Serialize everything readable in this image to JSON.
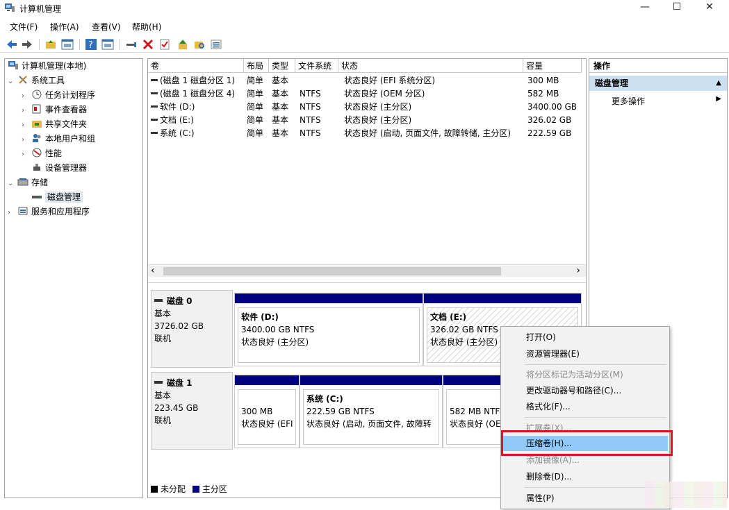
{
  "window": {
    "title": "计算机管理",
    "minimize": "—",
    "maximize": "☐",
    "close": "✕"
  },
  "menu": [
    "文件(F)",
    "操作(A)",
    "查看(V)",
    "帮助(H)"
  ],
  "toolbar": [
    "back-arrow-icon",
    "forward-arrow-icon",
    "up-folder-icon",
    "properties-icon",
    "help-icon",
    "view-icon",
    "connect-icon",
    "delete-icon",
    "check-icon",
    "up-arrow-icon",
    "search-folder-icon",
    "list-icon"
  ],
  "tree": {
    "root": "计算机管理(本地)",
    "items": [
      {
        "label": "系统工具",
        "arrow": "⌄"
      },
      {
        "label": "任务计划程序",
        "arrow": "›"
      },
      {
        "label": "事件查看器",
        "arrow": "›"
      },
      {
        "label": "共享文件夹",
        "arrow": "›"
      },
      {
        "label": "本地用户和组",
        "arrow": "›"
      },
      {
        "label": "性能",
        "arrow": "›"
      },
      {
        "label": "设备管理器",
        "arrow": ""
      },
      {
        "label": "存储",
        "arrow": "⌄"
      },
      {
        "label": "磁盘管理",
        "arrow": ""
      },
      {
        "label": "服务和应用程序",
        "arrow": "›"
      }
    ]
  },
  "volumes": {
    "columns": [
      "卷",
      "布局",
      "类型",
      "文件系统",
      "状态",
      "容量"
    ],
    "rows": [
      [
        "(磁盘 1 磁盘分区 1)",
        "简单",
        "基本",
        "",
        "状态良好 (EFI 系统分区)",
        "300 MB"
      ],
      [
        "(磁盘 1 磁盘分区 4)",
        "简单",
        "基本",
        "NTFS",
        "状态良好 (OEM 分区)",
        "582 MB"
      ],
      [
        "软件 (D:)",
        "简单",
        "基本",
        "NTFS",
        "状态良好 (主分区)",
        "3400.00 GB"
      ],
      [
        "文档 (E:)",
        "简单",
        "基本",
        "NTFS",
        "状态良好 (主分区)",
        "326.02 GB"
      ],
      [
        "系统 (C:)",
        "简单",
        "基本",
        "NTFS",
        "状态良好 (启动, 页面文件, 故障转储, 主分区)",
        "222.59 GB"
      ]
    ],
    "scroll_left": "‹",
    "scroll_right": "›"
  },
  "disks": [
    {
      "name": "磁盘 0",
      "type": "基本",
      "size": "3726.02 GB",
      "status": "联机",
      "partitions": [
        {
          "name": "软件 (D:)",
          "size": "3400.00 GB NTFS",
          "status": "状态良好 (主分区)"
        },
        {
          "name": "文档 (E:)",
          "size": "326.02 GB NTFS",
          "status": "状态良好 (主分区)"
        }
      ]
    },
    {
      "name": "磁盘 1",
      "type": "基本",
      "size": "223.45 GB",
      "status": "联机",
      "partitions": [
        {
          "name": "",
          "size": "300 MB",
          "status": "状态良好 (EFI"
        },
        {
          "name": "系统 (C:)",
          "size": "222.59 GB NTFS",
          "status": "状态良好 (启动, 页面文件, 故障转"
        },
        {
          "name": "",
          "size": "582 MB NTF",
          "status": "状态良好 (OE"
        }
      ]
    }
  ],
  "legend": {
    "unallocated": "未分配",
    "primary": "主分区",
    "unallocated_color": "#000000",
    "primary_color": "#00007f"
  },
  "actions": {
    "header": "操作",
    "section": "磁盘管理",
    "more": "更多操作"
  },
  "context_menu": [
    {
      "label": "打开(O)",
      "enabled": true
    },
    {
      "label": "资源管理器(E)",
      "enabled": true
    },
    {
      "label": "将分区标记为活动分区(M)",
      "enabled": false
    },
    {
      "label": "更改驱动器号和路径(C)...",
      "enabled": true
    },
    {
      "label": "格式化(F)...",
      "enabled": true
    },
    {
      "label": "扩展卷(X)...",
      "enabled": false
    },
    {
      "label": "压缩卷(H)...",
      "enabled": true,
      "highlighted": true
    },
    {
      "label": "添加镜像(A)...",
      "enabled": false
    },
    {
      "label": "删除卷(D)...",
      "enabled": true
    },
    {
      "label": "属性(P)",
      "enabled": true
    }
  ],
  "colors": {
    "accent_highlight": "#91c9f7",
    "callout_red": "#e0141e",
    "partition_bar": "#00007f",
    "section_bg": "#cde0f2"
  }
}
